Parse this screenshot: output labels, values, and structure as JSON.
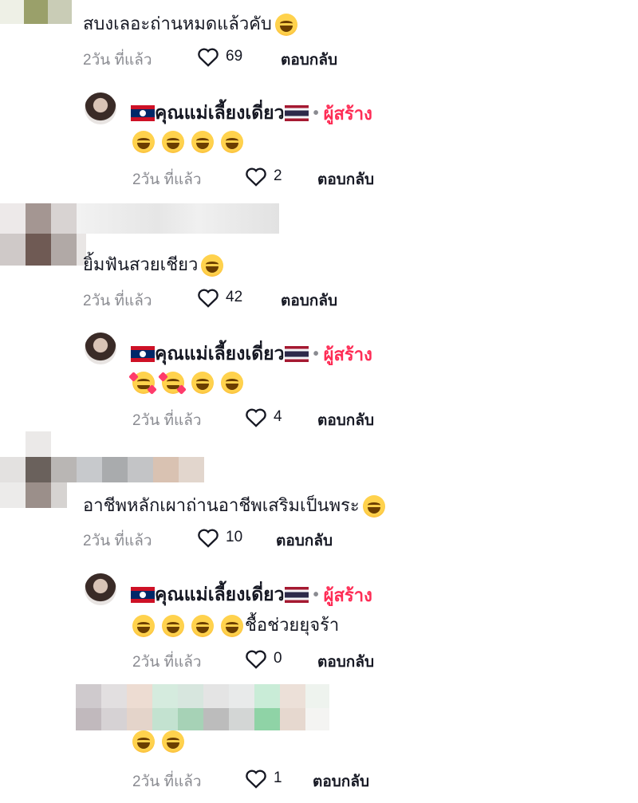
{
  "comments": [
    {
      "id": "c1",
      "text": "สบงเลอะถ่านหมดแล้วคับ",
      "emoji": "😂",
      "time": "2วัน ที่แล้ว",
      "likes": "69",
      "reply_label": "ตอบกลับ",
      "creator_reply": {
        "name": "คุณแม่เลี้ยงเดี่ยว",
        "badge": "ผู้สร้าง",
        "text": "😂😂😂😂",
        "time": "2วัน ที่แล้ว",
        "likes": "2",
        "reply_label": "ตอบกลับ"
      }
    },
    {
      "id": "c2",
      "text": "ยิ้มฟันสวยเชียว",
      "emoji": "😁",
      "time": "2วัน ที่แล้ว",
      "likes": "42",
      "reply_label": "ตอบกลับ",
      "creator_reply": {
        "name": "คุณแม่เลี้ยงเดี่ยว",
        "badge": "ผู้สร้าง",
        "text": "🥰🥰😂😂",
        "time": "2วัน ที่แล้ว",
        "likes": "4",
        "reply_label": "ตอบกลับ"
      }
    },
    {
      "id": "c3",
      "text": "อาชีพหลักเผาถ่านอาชีพเสริมเป็นพระ",
      "emoji": "😂",
      "time": "2วัน ที่แล้ว",
      "likes": "10",
      "reply_label": "ตอบกลับ",
      "creator_reply": {
        "name": "คุณแม่เลี้ยงเดี่ยว",
        "badge": "ผู้สร้าง",
        "text": "😂😂😂😂ชื้อช่วยยุจร้า",
        "suffix": "ชื้อช่วยยุจร้า",
        "time": "2วัน ที่แล้ว",
        "likes": "0",
        "reply_label": "ตอบกลับ"
      }
    },
    {
      "id": "c4",
      "text": "😂😂",
      "time": "2วัน ที่แล้ว",
      "likes": "1",
      "reply_label": "ตอบกลับ"
    }
  ],
  "colors": {
    "creator_badge": "#fe2c55",
    "meta_text": "#8a8b91",
    "primary_text": "#161823"
  },
  "icons": [
    "heart-icon",
    "laos-flag-icon",
    "thailand-flag-icon",
    "laughing-emoji-icon",
    "grinning-emoji-icon",
    "smiling-hearts-emoji-icon"
  ]
}
